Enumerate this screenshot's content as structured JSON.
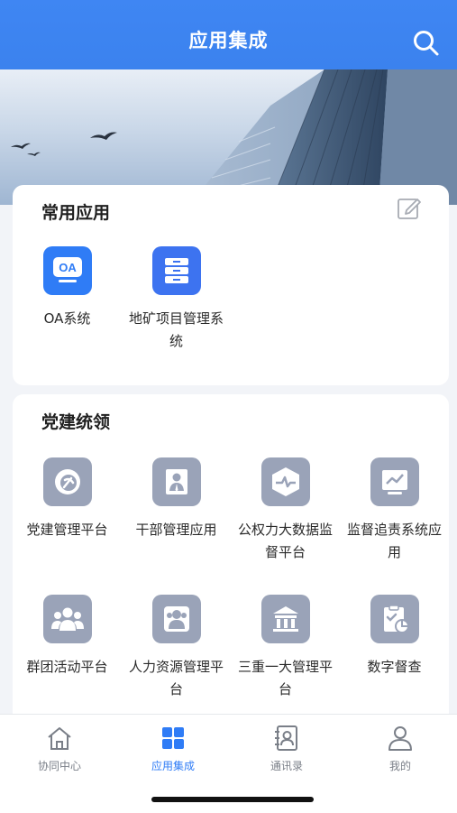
{
  "header": {
    "title": "应用集成",
    "search_icon": "search-icon"
  },
  "common_apps": {
    "title": "常用应用",
    "edit_icon": "edit-icon",
    "items": [
      {
        "label": "OA系统",
        "icon": "oa-icon"
      },
      {
        "label": "地矿项目管理系统",
        "icon": "database-icon"
      }
    ]
  },
  "party": {
    "title": "党建统领",
    "items": [
      {
        "label": "党建管理平台",
        "icon": "party-emblem-icon"
      },
      {
        "label": "干部管理应用",
        "icon": "cadre-icon"
      },
      {
        "label": "公权力大数据监督平台",
        "icon": "monitor-pulse-icon"
      },
      {
        "label": "监督追责系统应用",
        "icon": "chart-screen-icon"
      },
      {
        "label": "群团活动平台",
        "icon": "group-icon"
      },
      {
        "label": "人力资源管理平台",
        "icon": "hr-icon"
      },
      {
        "label": "三重一大管理平台",
        "icon": "building-icon"
      },
      {
        "label": "数字督查",
        "icon": "checklist-icon"
      }
    ]
  },
  "tabbar": {
    "items": [
      {
        "label": "协同中心",
        "icon": "home-icon",
        "active": false
      },
      {
        "label": "应用集成",
        "icon": "grid-icon",
        "active": true
      },
      {
        "label": "通讯录",
        "icon": "contacts-icon",
        "active": false
      },
      {
        "label": "我的",
        "icon": "user-icon",
        "active": false
      }
    ]
  },
  "colors": {
    "accent": "#2f7cf6",
    "header": "#3b82ee",
    "icon_gray": "#9aa3b8"
  }
}
